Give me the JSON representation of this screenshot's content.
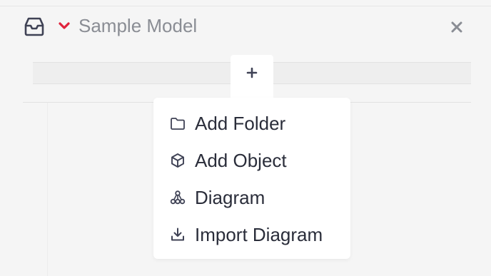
{
  "header": {
    "title": "Sample Model",
    "icons": {
      "inbox": "inbox-icon",
      "chevron": "chevron-down-icon",
      "close": "close-icon"
    }
  },
  "toolbar": {
    "add_label": "+"
  },
  "menu": {
    "items": [
      {
        "label": "Add Folder",
        "icon": "folder-icon"
      },
      {
        "label": "Add Object",
        "icon": "cube-icon"
      },
      {
        "label": "Diagram",
        "icon": "hierarchy-icon"
      },
      {
        "label": "Import Diagram",
        "icon": "import-icon"
      }
    ]
  },
  "colors": {
    "background": "#f5f5f5",
    "title": "#8a8d94",
    "chevron": "#e0233c",
    "icon": "#3f4255",
    "text": "#2a2d3a",
    "menu_bg": "#ffffff"
  }
}
